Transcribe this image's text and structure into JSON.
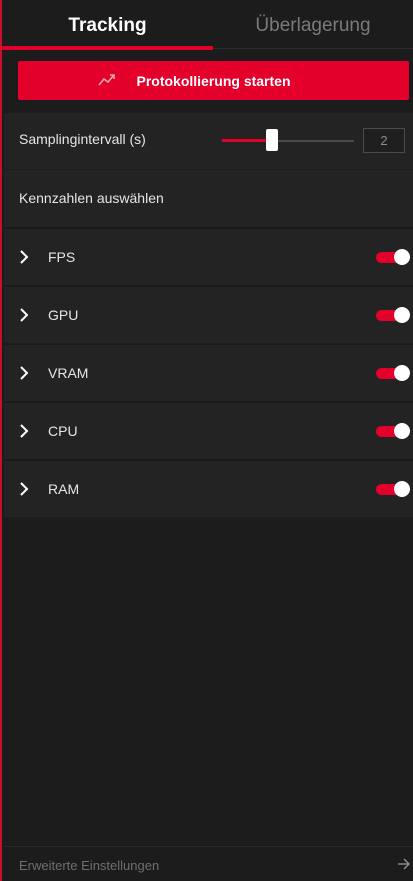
{
  "tabs": [
    {
      "label": "Tracking",
      "active": true
    },
    {
      "label": "Überlagerung",
      "active": false
    }
  ],
  "start_button": {
    "label": "Protokollierung starten",
    "icon": "trend-up-icon"
  },
  "sampling": {
    "label": "Samplingintervall (s)",
    "value": "2",
    "slider_fraction": 0.38
  },
  "metrics": {
    "header": "Kennzahlen auswählen",
    "items": [
      {
        "name": "FPS",
        "enabled": true
      },
      {
        "name": "GPU",
        "enabled": true
      },
      {
        "name": "VRAM",
        "enabled": true
      },
      {
        "name": "CPU",
        "enabled": true
      },
      {
        "name": "RAM",
        "enabled": true
      }
    ]
  },
  "footer": {
    "label": "Erweiterte Einstellungen",
    "icon": "arrow-right-icon"
  },
  "colors": {
    "accent": "#e3002b",
    "background": "#1c1c1c",
    "row": "#232323"
  }
}
